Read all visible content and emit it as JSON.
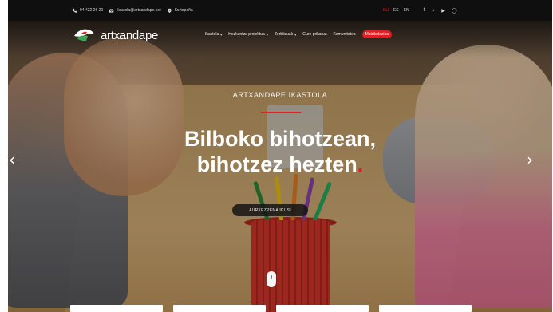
{
  "topbar": {
    "phone": "94 422 26 20",
    "email": "ikastola@artxandape.net",
    "location": "Kortopeña",
    "languages": [
      {
        "label": "EU",
        "active": true
      },
      {
        "label": "ES",
        "active": false
      },
      {
        "label": "EN",
        "active": false
      }
    ],
    "social": [
      "facebook-icon",
      "twitter-icon",
      "youtube-icon",
      "instagram-icon"
    ]
  },
  "header": {
    "brand": "artxandape",
    "nav": [
      {
        "label": "Ikastola",
        "has_dropdown": true
      },
      {
        "label": "Hezkuntza proiektua",
        "has_dropdown": true
      },
      {
        "label": "Zerbitzuak",
        "has_dropdown": true
      },
      {
        "label": "Gure prikatua",
        "has_dropdown": false
      },
      {
        "label": "Komunitatea",
        "has_dropdown": false
      }
    ],
    "cta": "Matrikulazioa"
  },
  "hero": {
    "eyebrow": "ARTXANDAPE IKASTOLA",
    "headline_line1": "Bilboko bihotzean,",
    "headline_line2": "bihotzez hezten",
    "headline_dot": ".",
    "button": "AURKEZPENA IKUSI"
  },
  "colors": {
    "accent": "#e01e24",
    "topbar": "#0f0f0f"
  }
}
